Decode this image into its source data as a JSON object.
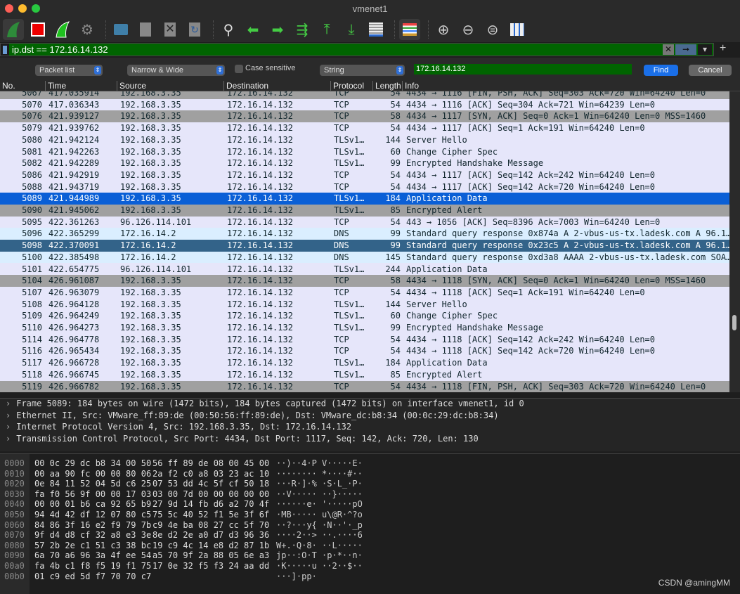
{
  "window": {
    "title": "vmenet1"
  },
  "toolbar": {
    "icons": [
      "start-capture-icon",
      "stop-capture-icon",
      "restart-capture-icon",
      "capture-options-icon",
      "open-file-icon",
      "save-file-icon",
      "close-file-icon",
      "reload-file-icon",
      "find-packet-icon",
      "go-back-icon",
      "go-forward-icon",
      "go-to-packet-icon",
      "first-packet-icon",
      "last-packet-icon",
      "autoscroll-icon",
      "colorize-icon",
      "zoom-in-icon",
      "zoom-out-icon",
      "normal-size-icon",
      "resize-columns-icon"
    ]
  },
  "filter": {
    "value": "ip.dst == 172.16.14.132",
    "color": "#006400"
  },
  "find": {
    "search_in": "Packet list",
    "char_width": "Narrow & Wide",
    "case_sensitive_label": "Case sensitive",
    "case_sensitive": false,
    "type": "String",
    "value": "172.16.14.132",
    "find_label": "Find",
    "cancel_label": "Cancel"
  },
  "columns": [
    "No.",
    "Time",
    "Source",
    "Destination",
    "Protocol",
    "Length",
    "Info"
  ],
  "colors": {
    "tcp": "#e6e6fa",
    "syn_fin": "#a0a0a0",
    "dns": "#daeeff",
    "selected": "#0a5fd6",
    "dns_marked": "#336389"
  },
  "packets": [
    {
      "no": "5067",
      "time": "417.035914",
      "src": "192.168.3.35",
      "dst": "172.16.14.132",
      "proto": "TCP",
      "len": "54",
      "info": "4434 → 1116 [FIN, PSH, ACK] Seq=303 Ack=720 Win=64240 Len=0",
      "style": "syn_fin"
    },
    {
      "no": "5070",
      "time": "417.036343",
      "src": "192.168.3.35",
      "dst": "172.16.14.132",
      "proto": "TCP",
      "len": "54",
      "info": "4434 → 1116 [ACK] Seq=304 Ack=721 Win=64239 Len=0",
      "style": "tcp"
    },
    {
      "no": "5076",
      "time": "421.939127",
      "src": "192.168.3.35",
      "dst": "172.16.14.132",
      "proto": "TCP",
      "len": "58",
      "info": "4434 → 1117 [SYN, ACK] Seq=0 Ack=1 Win=64240 Len=0 MSS=1460",
      "style": "syn_fin"
    },
    {
      "no": "5079",
      "time": "421.939762",
      "src": "192.168.3.35",
      "dst": "172.16.14.132",
      "proto": "TCP",
      "len": "54",
      "info": "4434 → 1117 [ACK] Seq=1 Ack=191 Win=64240 Len=0",
      "style": "tcp"
    },
    {
      "no": "5080",
      "time": "421.942124",
      "src": "192.168.3.35",
      "dst": "172.16.14.132",
      "proto": "TLSv1…",
      "len": "144",
      "info": "Server Hello",
      "style": "tcp"
    },
    {
      "no": "5081",
      "time": "421.942263",
      "src": "192.168.3.35",
      "dst": "172.16.14.132",
      "proto": "TLSv1…",
      "len": "60",
      "info": "Change Cipher Spec",
      "style": "tcp"
    },
    {
      "no": "5082",
      "time": "421.942289",
      "src": "192.168.3.35",
      "dst": "172.16.14.132",
      "proto": "TLSv1…",
      "len": "99",
      "info": "Encrypted Handshake Message",
      "style": "tcp"
    },
    {
      "no": "5086",
      "time": "421.942919",
      "src": "192.168.3.35",
      "dst": "172.16.14.132",
      "proto": "TCP",
      "len": "54",
      "info": "4434 → 1117 [ACK] Seq=142 Ack=242 Win=64240 Len=0",
      "style": "tcp"
    },
    {
      "no": "5088",
      "time": "421.943719",
      "src": "192.168.3.35",
      "dst": "172.16.14.132",
      "proto": "TCP",
      "len": "54",
      "info": "4434 → 1117 [ACK] Seq=142 Ack=720 Win=64240 Len=0",
      "style": "tcp"
    },
    {
      "no": "5089",
      "time": "421.944989",
      "src": "192.168.3.35",
      "dst": "172.16.14.132",
      "proto": "TLSv1…",
      "len": "184",
      "info": "Application Data",
      "style": "selected"
    },
    {
      "no": "5090",
      "time": "421.945062",
      "src": "192.168.3.35",
      "dst": "172.16.14.132",
      "proto": "TLSv1…",
      "len": "85",
      "info": "Encrypted Alert",
      "style": "syn_fin"
    },
    {
      "no": "5095",
      "time": "422.361263",
      "src": "96.126.114.101",
      "dst": "172.16.14.132",
      "proto": "TCP",
      "len": "54",
      "info": "443 → 1056 [ACK] Seq=8396 Ack=7003 Win=64240 Len=0",
      "style": "tcp"
    },
    {
      "no": "5096",
      "time": "422.365299",
      "src": "172.16.14.2",
      "dst": "172.16.14.132",
      "proto": "DNS",
      "len": "99",
      "info": "Standard query response 0x874a A 2-vbus-us-tx.ladesk.com A 96.1…",
      "style": "dns"
    },
    {
      "no": "5098",
      "time": "422.370091",
      "src": "172.16.14.2",
      "dst": "172.16.14.132",
      "proto": "DNS",
      "len": "99",
      "info": "Standard query response 0x23c5 A 2-vbus-us-tx.ladesk.com A 96.1…",
      "style": "dns_marked"
    },
    {
      "no": "5100",
      "time": "422.385498",
      "src": "172.16.14.2",
      "dst": "172.16.14.132",
      "proto": "DNS",
      "len": "145",
      "info": "Standard query response 0xd3a8 AAAA 2-vbus-us-tx.ladesk.com SOA…",
      "style": "dns"
    },
    {
      "no": "5101",
      "time": "422.654775",
      "src": "96.126.114.101",
      "dst": "172.16.14.132",
      "proto": "TLSv1…",
      "len": "244",
      "info": "Application Data",
      "style": "tcp"
    },
    {
      "no": "5104",
      "time": "426.961087",
      "src": "192.168.3.35",
      "dst": "172.16.14.132",
      "proto": "TCP",
      "len": "58",
      "info": "4434 → 1118 [SYN, ACK] Seq=0 Ack=1 Win=64240 Len=0 MSS=1460",
      "style": "syn_fin"
    },
    {
      "no": "5107",
      "time": "426.963079",
      "src": "192.168.3.35",
      "dst": "172.16.14.132",
      "proto": "TCP",
      "len": "54",
      "info": "4434 → 1118 [ACK] Seq=1 Ack=191 Win=64240 Len=0",
      "style": "tcp"
    },
    {
      "no": "5108",
      "time": "426.964128",
      "src": "192.168.3.35",
      "dst": "172.16.14.132",
      "proto": "TLSv1…",
      "len": "144",
      "info": "Server Hello",
      "style": "tcp"
    },
    {
      "no": "5109",
      "time": "426.964249",
      "src": "192.168.3.35",
      "dst": "172.16.14.132",
      "proto": "TLSv1…",
      "len": "60",
      "info": "Change Cipher Spec",
      "style": "tcp"
    },
    {
      "no": "5110",
      "time": "426.964273",
      "src": "192.168.3.35",
      "dst": "172.16.14.132",
      "proto": "TLSv1…",
      "len": "99",
      "info": "Encrypted Handshake Message",
      "style": "tcp"
    },
    {
      "no": "5114",
      "time": "426.964778",
      "src": "192.168.3.35",
      "dst": "172.16.14.132",
      "proto": "TCP",
      "len": "54",
      "info": "4434 → 1118 [ACK] Seq=142 Ack=242 Win=64240 Len=0",
      "style": "tcp"
    },
    {
      "no": "5116",
      "time": "426.965434",
      "src": "192.168.3.35",
      "dst": "172.16.14.132",
      "proto": "TCP",
      "len": "54",
      "info": "4434 → 1118 [ACK] Seq=142 Ack=720 Win=64240 Len=0",
      "style": "tcp"
    },
    {
      "no": "5117",
      "time": "426.966728",
      "src": "192.168.3.35",
      "dst": "172.16.14.132",
      "proto": "TLSv1…",
      "len": "184",
      "info": "Application Data",
      "style": "tcp"
    },
    {
      "no": "5118",
      "time": "426.966745",
      "src": "192.168.3.35",
      "dst": "172.16.14.132",
      "proto": "TLSv1…",
      "len": "85",
      "info": "Encrypted Alert",
      "style": "tcp"
    },
    {
      "no": "5119",
      "time": "426.966782",
      "src": "192.168.3.35",
      "dst": "172.16.14.132",
      "proto": "TCP",
      "len": "54",
      "info": "4434 → 1118 [FIN, PSH, ACK] Seq=303 Ack=720 Win=64240 Len=0",
      "style": "syn_fin"
    }
  ],
  "details": [
    "Frame 5089: 184 bytes on wire (1472 bits), 184 bytes captured (1472 bits) on interface vmenet1, id 0",
    "Ethernet II, Src: VMware_ff:89:de (00:50:56:ff:89:de), Dst: VMware_dc:b8:34 (00:0c:29:dc:b8:34)",
    "Internet Protocol Version 4, Src: 192.168.3.35, Dst: 172.16.14.132",
    "Transmission Control Protocol, Src Port: 4434, Dst Port: 1117, Seq: 142, Ack: 720, Len: 130"
  ],
  "hex": [
    {
      "off": "0000",
      "h1": "00 0c 29 dc b8 34 00 50",
      "h2": "56 ff 89 de 08 00 45 00",
      "ascii": "··)··4·P V·····E·"
    },
    {
      "off": "0010",
      "h1": "00 aa 90 fc 00 00 80 06",
      "h2": "2a f2 c0 a8 03 23 ac 10",
      "ascii": "········ *····#··"
    },
    {
      "off": "0020",
      "h1": "0e 84 11 52 04 5d c6 25",
      "h2": "07 53 dd 4c 5f cf 50 18",
      "ascii": "···R·]·% ·S·L_·P·"
    },
    {
      "off": "0030",
      "h1": "fa f0 56 9f 00 00 17 03",
      "h2": "03 00 7d 00 00 00 00 00",
      "ascii": "··V····· ··}·····"
    },
    {
      "off": "0040",
      "h1": "00 00 01 b6 ca 92 65 b9",
      "h2": "27 9d 14 fb d6 a2 70 4f",
      "ascii": "······e· '·····pO"
    },
    {
      "off": "0050",
      "h1": "94 4d 42 df 12 07 80 c5",
      "h2": "75 5c 40 52 f1 5e 3f 6f",
      "ascii": "·MB····· u\\@R·^?o"
    },
    {
      "off": "0060",
      "h1": "84 86 3f 16 e2 f9 79 7b",
      "h2": "c9 4e ba 08 27 cc 5f 70",
      "ascii": "··?···y{ ·N··'·_p"
    },
    {
      "off": "0070",
      "h1": "9f d4 d8 cf 32 a8 e3 3e",
      "h2": "8e d2 2e a0 d7 d3 96 36",
      "ascii": "····2··> ··.····6"
    },
    {
      "off": "0080",
      "h1": "57 2b 2e c1 51 c3 38 bc",
      "h2": "19 c9 4c 14 e8 d2 87 1b",
      "ascii": "W+.·Q·8· ··L·····"
    },
    {
      "off": "0090",
      "h1": "6a 70 a6 96 3a 4f ee 54",
      "h2": "a5 70 9f 2a 88 05 6e a3",
      "ascii": "jp··:O·T ·p·*··n·"
    },
    {
      "off": "00a0",
      "h1": "fa 4b c1 f8 f5 19 f1 75",
      "h2": "17 0e 32 f5 f3 24 aa dd",
      "ascii": "·K·····u ··2··$··"
    },
    {
      "off": "00b0",
      "h1": "01 c9 ed 5d f7 70 70 c7",
      "h2": "",
      "ascii": "···]·pp·"
    }
  ],
  "watermark": "CSDN @amingMM"
}
